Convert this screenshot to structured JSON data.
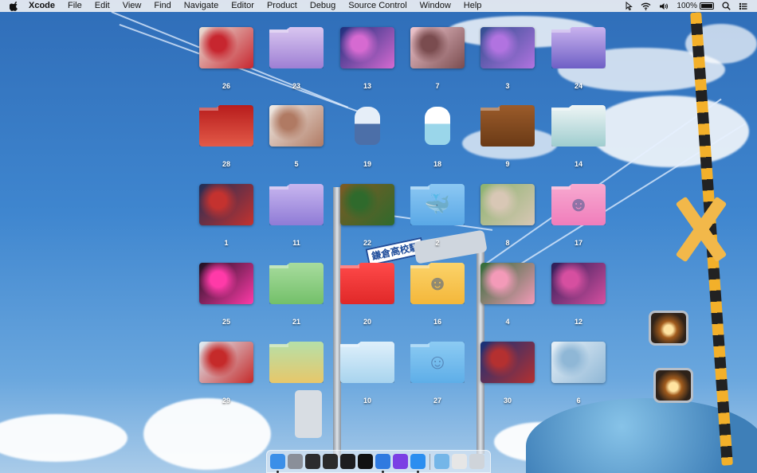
{
  "menubar": {
    "apple_icon": "apple-icon",
    "app_name": "Xcode",
    "items": [
      "File",
      "Edit",
      "View",
      "Find",
      "Navigate",
      "Editor",
      "Product",
      "Debug",
      "Source Control",
      "Window",
      "Help"
    ],
    "status": {
      "battery_percent": "100%",
      "battery_level": 1.0,
      "icons": [
        "cursor-icon",
        "wifi-icon",
        "volume-icon",
        "battery-icon",
        "search-icon",
        "control-center-icon"
      ]
    }
  },
  "desktop": {
    "items": [
      {
        "label": "26",
        "kind": "image",
        "colors": [
          "#e9e1d8",
          "#c7262f"
        ]
      },
      {
        "label": "23",
        "kind": "folder",
        "colors": [
          "#d9c6f0",
          "#9e7fd4"
        ]
      },
      {
        "label": "13",
        "kind": "image",
        "colors": [
          "#1b2f7c",
          "#d66ad1"
        ]
      },
      {
        "label": "7",
        "kind": "image",
        "colors": [
          "#f0c7cf",
          "#7a4c4f"
        ]
      },
      {
        "label": "3",
        "kind": "image",
        "colors": [
          "#2f4e8f",
          "#b173e0"
        ]
      },
      {
        "label": "24",
        "kind": "folder",
        "colors": [
          "#c9b2ee",
          "#6e5fc5"
        ]
      },
      {
        "label": "28",
        "kind": "folder",
        "colors": [
          "#b71c1c",
          "#e35a48"
        ]
      },
      {
        "label": "5",
        "kind": "image",
        "colors": [
          "#f1ede8",
          "#b07a63"
        ]
      },
      {
        "label": "19",
        "kind": "sticker",
        "colors": [
          "#e6eef8",
          "#4c6fa8"
        ]
      },
      {
        "label": "18",
        "kind": "sticker",
        "colors": [
          "#ffffff",
          "#9ad6ea"
        ]
      },
      {
        "label": "9",
        "kind": "folder",
        "colors": [
          "#9b5b2a",
          "#6a3a16"
        ]
      },
      {
        "label": "14",
        "kind": "folder",
        "colors": [
          "#eef5f5",
          "#9fcdcf"
        ]
      },
      {
        "label": "1",
        "kind": "image",
        "colors": [
          "#1f2e57",
          "#c4322f"
        ]
      },
      {
        "label": "11",
        "kind": "folder",
        "colors": [
          "#c8b6ef",
          "#8f7bd6"
        ]
      },
      {
        "label": "22",
        "kind": "image",
        "colors": [
          "#7d5a24",
          "#2f6a2c"
        ]
      },
      {
        "label": "2",
        "kind": "folder",
        "colors": [
          "#8cc8f3",
          "#5aa8e6"
        ],
        "glyph": "whale"
      },
      {
        "label": "8",
        "kind": "image",
        "colors": [
          "#8bb26e",
          "#d8c7b5"
        ]
      },
      {
        "label": "17",
        "kind": "folder",
        "colors": [
          "#f7a9d0",
          "#f07dbb"
        ],
        "glyph": "girl"
      },
      {
        "label": "25",
        "kind": "image",
        "colors": [
          "#1c1020",
          "#ff3aa8"
        ]
      },
      {
        "label": "21",
        "kind": "folder",
        "colors": [
          "#a8dc9e",
          "#73c06a"
        ]
      },
      {
        "label": "20",
        "kind": "folder",
        "colors": [
          "#ff4a4a",
          "#e02828"
        ]
      },
      {
        "label": "16",
        "kind": "folder",
        "colors": [
          "#fbd36a",
          "#f4b73a"
        ],
        "glyph": "dino"
      },
      {
        "label": "4",
        "kind": "image",
        "colors": [
          "#2d6b35",
          "#f39ab8"
        ]
      },
      {
        "label": "12",
        "kind": "image",
        "colors": [
          "#2a1c55",
          "#d64fa0"
        ]
      },
      {
        "label": "29",
        "kind": "image",
        "colors": [
          "#dff1f8",
          "#c52a2a"
        ]
      },
      {
        "label": "",
        "kind": "folder",
        "colors": [
          "#b6e0a8",
          "#e7c76a"
        ]
      },
      {
        "label": "10",
        "kind": "folder",
        "colors": [
          "#dff0fb",
          "#a8d4ee"
        ]
      },
      {
        "label": "27",
        "kind": "folder",
        "colors": [
          "#8ccbf3",
          "#5eaee8"
        ],
        "glyph": "frog"
      },
      {
        "label": "30",
        "kind": "image",
        "colors": [
          "#12307a",
          "#b43030"
        ]
      },
      {
        "label": "6",
        "kind": "image",
        "colors": [
          "#e8f1f8",
          "#8fb7d6"
        ]
      }
    ]
  },
  "wallpaper": {
    "sign_text": "鎌倉高校駅"
  },
  "dock": {
    "apps": [
      {
        "name": "finder-icon",
        "color": "#3b8fe8",
        "running": true
      },
      {
        "name": "launchpad-icon",
        "color": "#8a8f99",
        "running": false
      },
      {
        "name": "mission-control-icon",
        "color": "#2c2c2e",
        "running": false
      },
      {
        "name": "console-icon",
        "color": "#2b2b2b",
        "running": false
      },
      {
        "name": "activity-monitor-icon",
        "color": "#1d1d1f",
        "running": false
      },
      {
        "name": "terminal-icon",
        "color": "#111111",
        "running": false
      },
      {
        "name": "xcode-icon",
        "color": "#2f7ae0",
        "running": true
      },
      {
        "name": "dash-icon",
        "color": "#7b3fe4",
        "running": false
      },
      {
        "name": "safari-icon",
        "color": "#2b8ef0",
        "running": true
      }
    ],
    "right": [
      {
        "name": "screenshot-folder-icon",
        "color": "#74b6e8"
      },
      {
        "name": "downloads-stack-icon",
        "color": "#e6e6e6"
      },
      {
        "name": "trash-icon",
        "color": "#cfd4da"
      }
    ]
  }
}
